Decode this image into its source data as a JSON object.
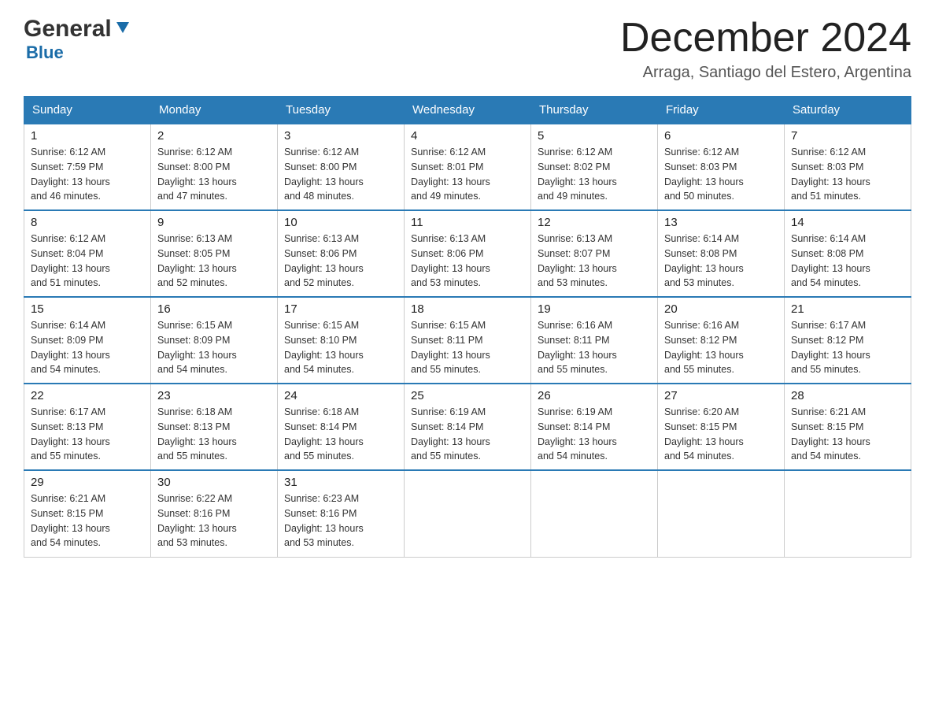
{
  "header": {
    "logo_general": "General",
    "logo_blue": "Blue",
    "title": "December 2024",
    "subtitle": "Arraga, Santiago del Estero, Argentina"
  },
  "calendar": {
    "days_of_week": [
      "Sunday",
      "Monday",
      "Tuesday",
      "Wednesday",
      "Thursday",
      "Friday",
      "Saturday"
    ],
    "weeks": [
      [
        {
          "day": "1",
          "sunrise": "6:12 AM",
          "sunset": "7:59 PM",
          "daylight": "13 hours and 46 minutes."
        },
        {
          "day": "2",
          "sunrise": "6:12 AM",
          "sunset": "8:00 PM",
          "daylight": "13 hours and 47 minutes."
        },
        {
          "day": "3",
          "sunrise": "6:12 AM",
          "sunset": "8:00 PM",
          "daylight": "13 hours and 48 minutes."
        },
        {
          "day": "4",
          "sunrise": "6:12 AM",
          "sunset": "8:01 PM",
          "daylight": "13 hours and 49 minutes."
        },
        {
          "day": "5",
          "sunrise": "6:12 AM",
          "sunset": "8:02 PM",
          "daylight": "13 hours and 49 minutes."
        },
        {
          "day": "6",
          "sunrise": "6:12 AM",
          "sunset": "8:03 PM",
          "daylight": "13 hours and 50 minutes."
        },
        {
          "day": "7",
          "sunrise": "6:12 AM",
          "sunset": "8:03 PM",
          "daylight": "13 hours and 51 minutes."
        }
      ],
      [
        {
          "day": "8",
          "sunrise": "6:12 AM",
          "sunset": "8:04 PM",
          "daylight": "13 hours and 51 minutes."
        },
        {
          "day": "9",
          "sunrise": "6:13 AM",
          "sunset": "8:05 PM",
          "daylight": "13 hours and 52 minutes."
        },
        {
          "day": "10",
          "sunrise": "6:13 AM",
          "sunset": "8:06 PM",
          "daylight": "13 hours and 52 minutes."
        },
        {
          "day": "11",
          "sunrise": "6:13 AM",
          "sunset": "8:06 PM",
          "daylight": "13 hours and 53 minutes."
        },
        {
          "day": "12",
          "sunrise": "6:13 AM",
          "sunset": "8:07 PM",
          "daylight": "13 hours and 53 minutes."
        },
        {
          "day": "13",
          "sunrise": "6:14 AM",
          "sunset": "8:08 PM",
          "daylight": "13 hours and 53 minutes."
        },
        {
          "day": "14",
          "sunrise": "6:14 AM",
          "sunset": "8:08 PM",
          "daylight": "13 hours and 54 minutes."
        }
      ],
      [
        {
          "day": "15",
          "sunrise": "6:14 AM",
          "sunset": "8:09 PM",
          "daylight": "13 hours and 54 minutes."
        },
        {
          "day": "16",
          "sunrise": "6:15 AM",
          "sunset": "8:09 PM",
          "daylight": "13 hours and 54 minutes."
        },
        {
          "day": "17",
          "sunrise": "6:15 AM",
          "sunset": "8:10 PM",
          "daylight": "13 hours and 54 minutes."
        },
        {
          "day": "18",
          "sunrise": "6:15 AM",
          "sunset": "8:11 PM",
          "daylight": "13 hours and 55 minutes."
        },
        {
          "day": "19",
          "sunrise": "6:16 AM",
          "sunset": "8:11 PM",
          "daylight": "13 hours and 55 minutes."
        },
        {
          "day": "20",
          "sunrise": "6:16 AM",
          "sunset": "8:12 PM",
          "daylight": "13 hours and 55 minutes."
        },
        {
          "day": "21",
          "sunrise": "6:17 AM",
          "sunset": "8:12 PM",
          "daylight": "13 hours and 55 minutes."
        }
      ],
      [
        {
          "day": "22",
          "sunrise": "6:17 AM",
          "sunset": "8:13 PM",
          "daylight": "13 hours and 55 minutes."
        },
        {
          "day": "23",
          "sunrise": "6:18 AM",
          "sunset": "8:13 PM",
          "daylight": "13 hours and 55 minutes."
        },
        {
          "day": "24",
          "sunrise": "6:18 AM",
          "sunset": "8:14 PM",
          "daylight": "13 hours and 55 minutes."
        },
        {
          "day": "25",
          "sunrise": "6:19 AM",
          "sunset": "8:14 PM",
          "daylight": "13 hours and 55 minutes."
        },
        {
          "day": "26",
          "sunrise": "6:19 AM",
          "sunset": "8:14 PM",
          "daylight": "13 hours and 54 minutes."
        },
        {
          "day": "27",
          "sunrise": "6:20 AM",
          "sunset": "8:15 PM",
          "daylight": "13 hours and 54 minutes."
        },
        {
          "day": "28",
          "sunrise": "6:21 AM",
          "sunset": "8:15 PM",
          "daylight": "13 hours and 54 minutes."
        }
      ],
      [
        {
          "day": "29",
          "sunrise": "6:21 AM",
          "sunset": "8:15 PM",
          "daylight": "13 hours and 54 minutes."
        },
        {
          "day": "30",
          "sunrise": "6:22 AM",
          "sunset": "8:16 PM",
          "daylight": "13 hours and 53 minutes."
        },
        {
          "day": "31",
          "sunrise": "6:23 AM",
          "sunset": "8:16 PM",
          "daylight": "13 hours and 53 minutes."
        },
        null,
        null,
        null,
        null
      ]
    ],
    "labels": {
      "sunrise": "Sunrise: ",
      "sunset": "Sunset: ",
      "daylight": "Daylight: "
    }
  }
}
